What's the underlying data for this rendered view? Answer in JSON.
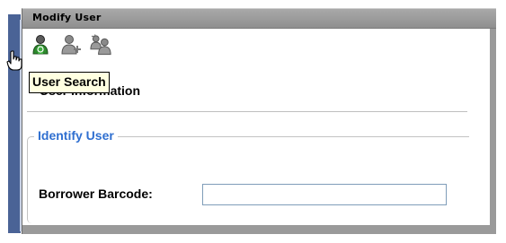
{
  "window": {
    "title": "Modify User"
  },
  "toolbar": {
    "buttons": [
      {
        "icon": "user-search-icon"
      },
      {
        "icon": "user-add-icon"
      },
      {
        "icon": "users-group-icon"
      }
    ]
  },
  "tooltip": {
    "text": "User Search"
  },
  "section": {
    "title": "User Information"
  },
  "identify_user": {
    "legend": "Identify User",
    "barcode_label": "Borrower Barcode:",
    "barcode_value": ""
  },
  "colors": {
    "legend_blue": "#2f6fd0",
    "tooltip_bg": "#ffffe1",
    "titlebar_gray": "#9a9a9a",
    "left_strip_blue": "#4a6396"
  }
}
